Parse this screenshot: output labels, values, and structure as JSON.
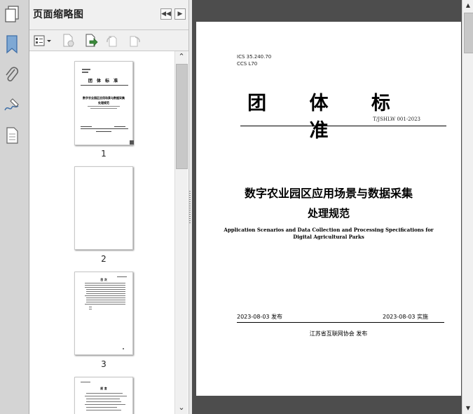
{
  "panel": {
    "title": "页面缩略图",
    "prev_glyph": "◀◀",
    "next_glyph": "▶"
  },
  "thumbnails": [
    {
      "label": "1"
    },
    {
      "label": "2"
    },
    {
      "label": "3"
    }
  ],
  "thumb1": {
    "heading": "团 体 标 准",
    "title": "数字农业园区应用场景与数据采集",
    "subtitle": "处理规范"
  },
  "thumb3": {
    "heading": "目 次"
  },
  "thumb4": {
    "heading": "前 言"
  },
  "document": {
    "ics": "ICS 35.240.70",
    "ccs": "CCS L70",
    "heading": "团 体 标 准",
    "code": "T/JSHLW 001-2023",
    "title_line1": "数字农业园区应用场景与数据采集",
    "title_line2": "处理规范",
    "english_line1": "Application Scenarios and Data Collection and Processing Specifications for",
    "english_line2": "Digital Agricultural Parks",
    "publish_date": "2023-08-03 发布",
    "implement_date": "2023-08-03 实施",
    "publisher": "江苏省互联网协会  发布"
  },
  "scroll": {
    "up_glyph": "▲",
    "down_glyph": "▼",
    "left_up_glyph": "⌃",
    "left_down_glyph": "⌄"
  },
  "colors": {
    "rail": "#d4d4d4",
    "panel": "#f0f0f0",
    "doc_background": "#4d4d4d",
    "icon_blue": "#3f6fa8",
    "icon_green": "#3c8a3c"
  }
}
